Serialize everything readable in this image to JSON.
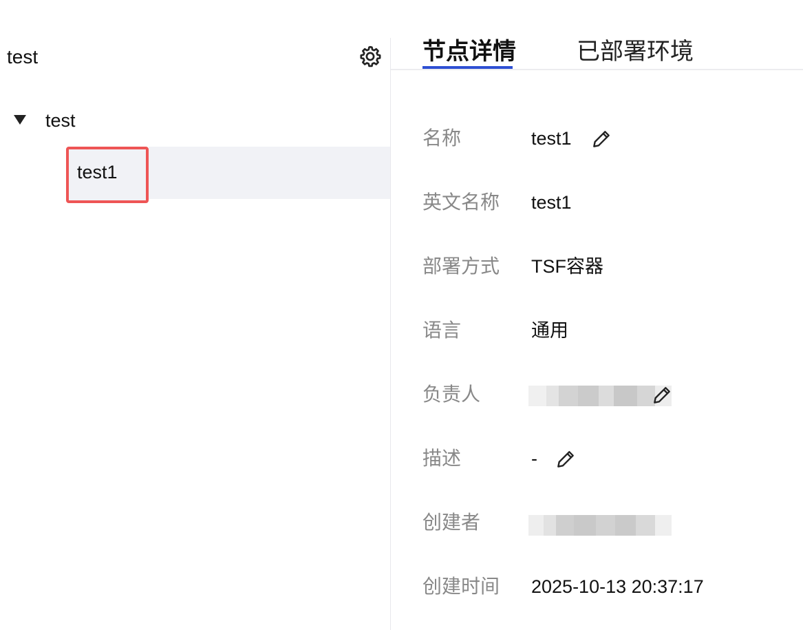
{
  "tree": {
    "title": "test",
    "root_label": "test",
    "child_label": "test1"
  },
  "tabs": [
    {
      "label": "节点详情",
      "active": true
    },
    {
      "label": "已部署环境",
      "active": false
    }
  ],
  "details": {
    "name": {
      "key": "名称",
      "value": "test1"
    },
    "english_name": {
      "key": "英文名称",
      "value": "test1"
    },
    "deploy_mode": {
      "key": "部署方式",
      "value": "TSF容器"
    },
    "language": {
      "key": "语言",
      "value": "通用"
    },
    "owner": {
      "key": "负责人"
    },
    "description": {
      "key": "描述",
      "value": "-"
    },
    "creator": {
      "key": "创建者"
    },
    "created_time": {
      "key": "创建时间",
      "value": "2025-10-13 20:37:17"
    }
  },
  "icons": {
    "settings": "gear-icon",
    "expand": "caret-down-icon",
    "edit": "pencil-icon"
  },
  "colors": {
    "accent": "#2e4fd3",
    "selection_border": "#ee5555",
    "selected_bg": "#f1f2f6",
    "label_gray": "#888888"
  }
}
